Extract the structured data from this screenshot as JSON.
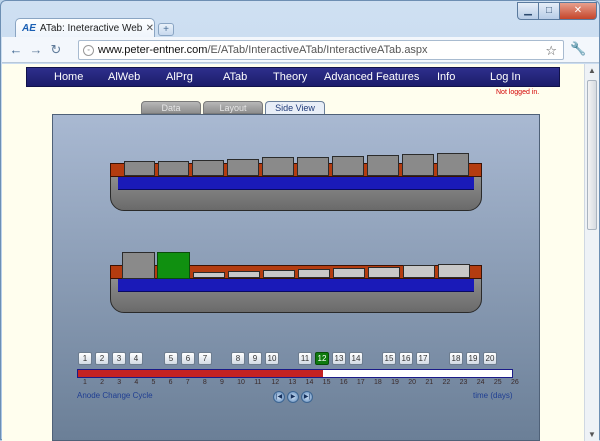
{
  "browser": {
    "tab_title": "ATab: Ineteractive Web P...",
    "tab_favicon": "AE",
    "url_prefix": "www.peter-entner.com",
    "url_rest": "/E/ATab/InteractiveATab/InteractiveATab.aspx",
    "icons": {
      "back": "arrow-left-icon",
      "forward": "arrow-right-icon",
      "reload": "reload-icon",
      "bookmark": "star-icon",
      "menu": "wrench-icon"
    }
  },
  "menu": {
    "items": [
      "Home",
      "AlWeb",
      "AlPrg",
      "ATab",
      "Theory",
      "Advanced Features",
      "Info",
      "Log In"
    ]
  },
  "status": {
    "login": "Not logged in."
  },
  "subtabs": [
    {
      "label": "Data",
      "active": false
    },
    {
      "label": "Layout",
      "active": false
    },
    {
      "label": "Side View",
      "active": true
    }
  ],
  "cycles": {
    "buttons": [
      "1",
      "2",
      "3",
      "4",
      "5",
      "6",
      "7",
      "8",
      "9",
      "10",
      "11",
      "12",
      "13",
      "14",
      "15",
      "16",
      "17",
      "18",
      "19",
      "20"
    ],
    "selected": "12",
    "ticks": [
      "1",
      "2",
      "3",
      "4",
      "5",
      "6",
      "7",
      "8",
      "9",
      "10",
      "11",
      "12",
      "13",
      "14",
      "15",
      "16",
      "17",
      "18",
      "19",
      "20",
      "21",
      "22",
      "23",
      "24",
      "25",
      "26"
    ],
    "progress": 0.565,
    "left_label": "Anode Change Cycle",
    "right_label": "time (days)"
  },
  "colors": {
    "menu_bg": "#1c1d6a",
    "selected": "#0e7a0e",
    "timeline_fill": "#c42222",
    "rust": "#b43c10",
    "water_line": "#1a1ab8"
  }
}
